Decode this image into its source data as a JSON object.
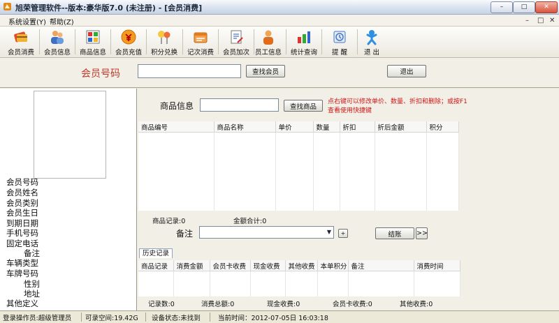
{
  "window": {
    "title": "旭荣管理软件--版本:豪华版7.0 (未注册) - [会员消费]",
    "minimize": "–",
    "maximize": "□",
    "close": "✕"
  },
  "menu": [
    "系统设置(Y)",
    "帮助(Z)"
  ],
  "mdi_controls": [
    "–",
    "□",
    "✕"
  ],
  "toolbar": [
    {
      "label": "会员消费",
      "icon": "member-consume-icon"
    },
    {
      "label": "会员信息",
      "icon": "member-info-icon"
    },
    {
      "label": "商品信息",
      "icon": "product-info-icon"
    },
    {
      "label": "会员充值",
      "icon": "member-recharge-icon"
    },
    {
      "label": "积分兑换",
      "icon": "points-exchange-icon"
    },
    {
      "label": "记次消费",
      "icon": "count-consume-icon"
    },
    {
      "label": "会员加次",
      "icon": "member-add-count-icon"
    },
    {
      "label": "员工信息",
      "icon": "staff-info-icon"
    },
    {
      "label": "统计查询",
      "icon": "statistics-icon"
    },
    {
      "label": "提 醒",
      "icon": "reminder-icon"
    },
    {
      "label": "退 出",
      "icon": "exit-icon"
    }
  ],
  "search": {
    "member_no_label": "会员号码",
    "member_no_value": "",
    "find_member": "查找会员",
    "exit": "退出"
  },
  "member_fields": [
    "会员号码",
    "会员姓名",
    "会员类别",
    "会员生日",
    "到期日期",
    "手机号码",
    "固定电话",
    "备注",
    "车辆类型",
    "车牌号码",
    "性别",
    "地址",
    "其他定义"
  ],
  "goods": {
    "label": "商品信息",
    "value": "",
    "find_goods": "查找商品",
    "hint": "点右键可以修改单价、数量、折扣和删除；或按F1查看使用快捷键"
  },
  "goods_table": {
    "columns": [
      "商品编号",
      "商品名称",
      "单价",
      "数量",
      "折扣",
      "折后金额",
      "积分"
    ],
    "rows": []
  },
  "goods_summary": {
    "records": "商品记录:0",
    "total": "金额合计:0"
  },
  "remark": {
    "label": "备注",
    "value": "",
    "plus": "+",
    "checkout": "结账",
    "more": ">>"
  },
  "history": {
    "tab": "历史记录",
    "columns": [
      "商品记录",
      "消费金额",
      "会员卡收费",
      "现金收费",
      "其他收费",
      "本单积分",
      "备注",
      "消费时间"
    ],
    "rows": [],
    "summary": {
      "count": "记录数:0",
      "total": "消费总额:0",
      "cash": "现金收费:0",
      "card": "会员卡收费:0",
      "other": "其他收费:0"
    }
  },
  "status": {
    "operator": "登录操作员:超级管理员",
    "space": "可录空间:19.42G",
    "device": "设备状态:未找到",
    "time": "当前时间：2012-07-05日 16:03:18"
  },
  "colors": {
    "accent_red": "#c0392b",
    "hint_red": "#d01515",
    "panel_bg": "#f1efe6"
  }
}
